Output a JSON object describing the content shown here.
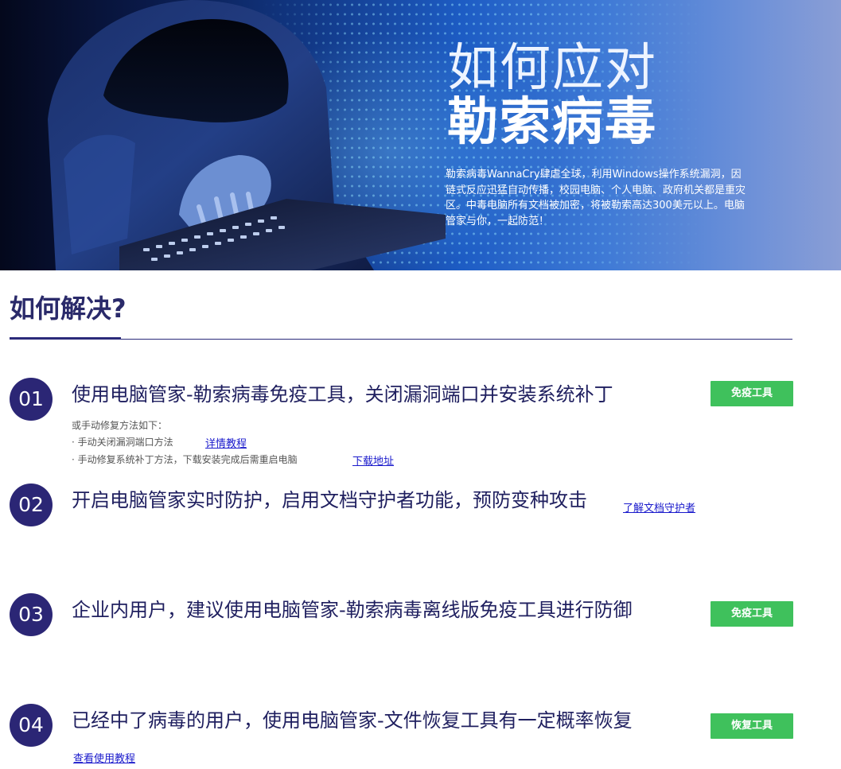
{
  "banner": {
    "title_line1": "如何应对",
    "title_line2": "勒索病毒",
    "description": "勒索病毒WannaCry肆虐全球，利用Windows操作系统漏洞，因链式反应迅猛自动传播，校园电脑、个人电脑、政府机关都是重灾区。中毒电脑所有文档被加密，将被勒索高达300美元以上。电脑管家与你，一起防范！"
  },
  "section": {
    "title": "如何解决?"
  },
  "steps": [
    {
      "number": "01",
      "title": "使用电脑管家-勒索病毒免疫工具，关闭漏洞端口并安装系统补丁",
      "button": "免疫工具",
      "note_heading": "或手动修复方法如下：",
      "note_1": "· 手动关闭漏洞端口方法",
      "note_1_link": "详情教程",
      "note_2": "· 手动修复系统补丁方法，下载安装完成后需重启电脑",
      "note_2_link": "下载地址"
    },
    {
      "number": "02",
      "title": "开启电脑管家实时防护，启用文档守护者功能，预防变种攻击",
      "link": "了解文档守护者"
    },
    {
      "number": "03",
      "title": "企业内用户，建议使用电脑管家-勒索病毒离线版免疫工具进行防御",
      "button": "免疫工具"
    },
    {
      "number": "04",
      "title": "已经中了病毒的用户，使用电脑管家-文件恢复工具有一定概率恢复",
      "button": "恢复工具",
      "link": "查看使用教程"
    }
  ],
  "colors": {
    "accent_navy": "#2b2675",
    "button_green": "#3fc15c",
    "link_blue": "#1a1acc"
  },
  "icons": {
    "hero_image": "hooded-hacker-with-laptop"
  }
}
